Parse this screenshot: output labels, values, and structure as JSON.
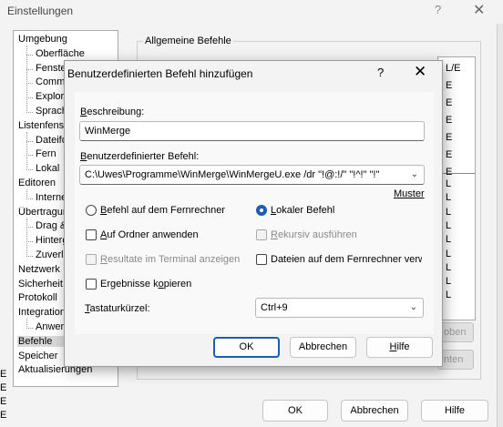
{
  "settings_window": {
    "title": "Einstellungen",
    "help_glyph": "?",
    "close_glyph": "✕",
    "tree_items": [
      {
        "label": "Umgebung",
        "level": 0
      },
      {
        "label": "Oberfläche",
        "level": 1
      },
      {
        "label": "Fenster",
        "level": 1
      },
      {
        "label": "Commander",
        "level": 1
      },
      {
        "label": "Explorer",
        "level": 1
      },
      {
        "label": "Sprachen",
        "level": 1
      },
      {
        "label": "Listenfenster",
        "level": 0
      },
      {
        "label": "Dateiformat",
        "level": 1
      },
      {
        "label": "Fern",
        "level": 1
      },
      {
        "label": "Lokal",
        "level": 1
      },
      {
        "label": "Editoren",
        "level": 0
      },
      {
        "label": "Interne",
        "level": 1
      },
      {
        "label": "Übertragung",
        "level": 0
      },
      {
        "label": "Drag & Drop",
        "level": 1
      },
      {
        "label": "Hintergrund",
        "level": 1
      },
      {
        "label": "Zuverlässigkeit",
        "level": 1
      },
      {
        "label": "Netzwerk",
        "level": 0
      },
      {
        "label": "Sicherheit",
        "level": 0
      },
      {
        "label": "Protokoll",
        "level": 0
      },
      {
        "label": "Integration",
        "level": 0
      },
      {
        "label": "Anwendungen",
        "level": 1
      },
      {
        "label": "Befehle",
        "level": 0,
        "selected": true
      },
      {
        "label": "Speicher",
        "level": 0
      },
      {
        "label": "Aktualisierungen",
        "level": 0
      }
    ],
    "group_label": "Allgemeine Befehle",
    "list_header": "L/E",
    "list_cells": [
      "E",
      "E",
      "E",
      "E",
      "E",
      "E",
      "L",
      "L",
      "L",
      "L",
      "L",
      "L",
      "L",
      "L",
      "L"
    ],
    "side_button_1": "oben",
    "side_button_2": "nten",
    "ok_label": "OK",
    "cancel_label": "Abbrechen",
    "help_label": "Hilfe",
    "left_edge_fragments": [
      "E",
      "E",
      "E",
      "E"
    ]
  },
  "dialog": {
    "title": "Benutzerdefinierten Befehl hinzufügen",
    "help_glyph": "?",
    "close_glyph": "✕",
    "description_label": "Beschreibung:",
    "description_value": "WinMerge",
    "command_label": "Benutzerdefinierter Befehl:",
    "command_value": "C:\\Uwes\\Programme\\WinMerge\\WinMergeU.exe  /dr \"!@:!/\" \"!^!\" \"!\"",
    "pattern_link": "Muster",
    "radio_remote": "Befehl auf dem Fernrechner",
    "radio_local": "Lokaler Befehl",
    "radio_selected": "local",
    "check_folders": "Auf Ordner anwenden",
    "check_recursive": "Rekursiv ausführen",
    "check_terminal": "Resultate im Terminal anzeigen",
    "check_remote_files": "Dateien auf dem Fernrechner verw",
    "check_copy_results": "Ergebnisse kopieren",
    "shortcut_label": "Tastaturkürzel:",
    "shortcut_value": "Ctrl+9",
    "ok_label": "OK",
    "cancel_label": "Abbrechen",
    "help_label": "Hilfe"
  },
  "colors": {
    "accent": "#1a5fb4",
    "disabled_text": "#8a8a8a"
  }
}
